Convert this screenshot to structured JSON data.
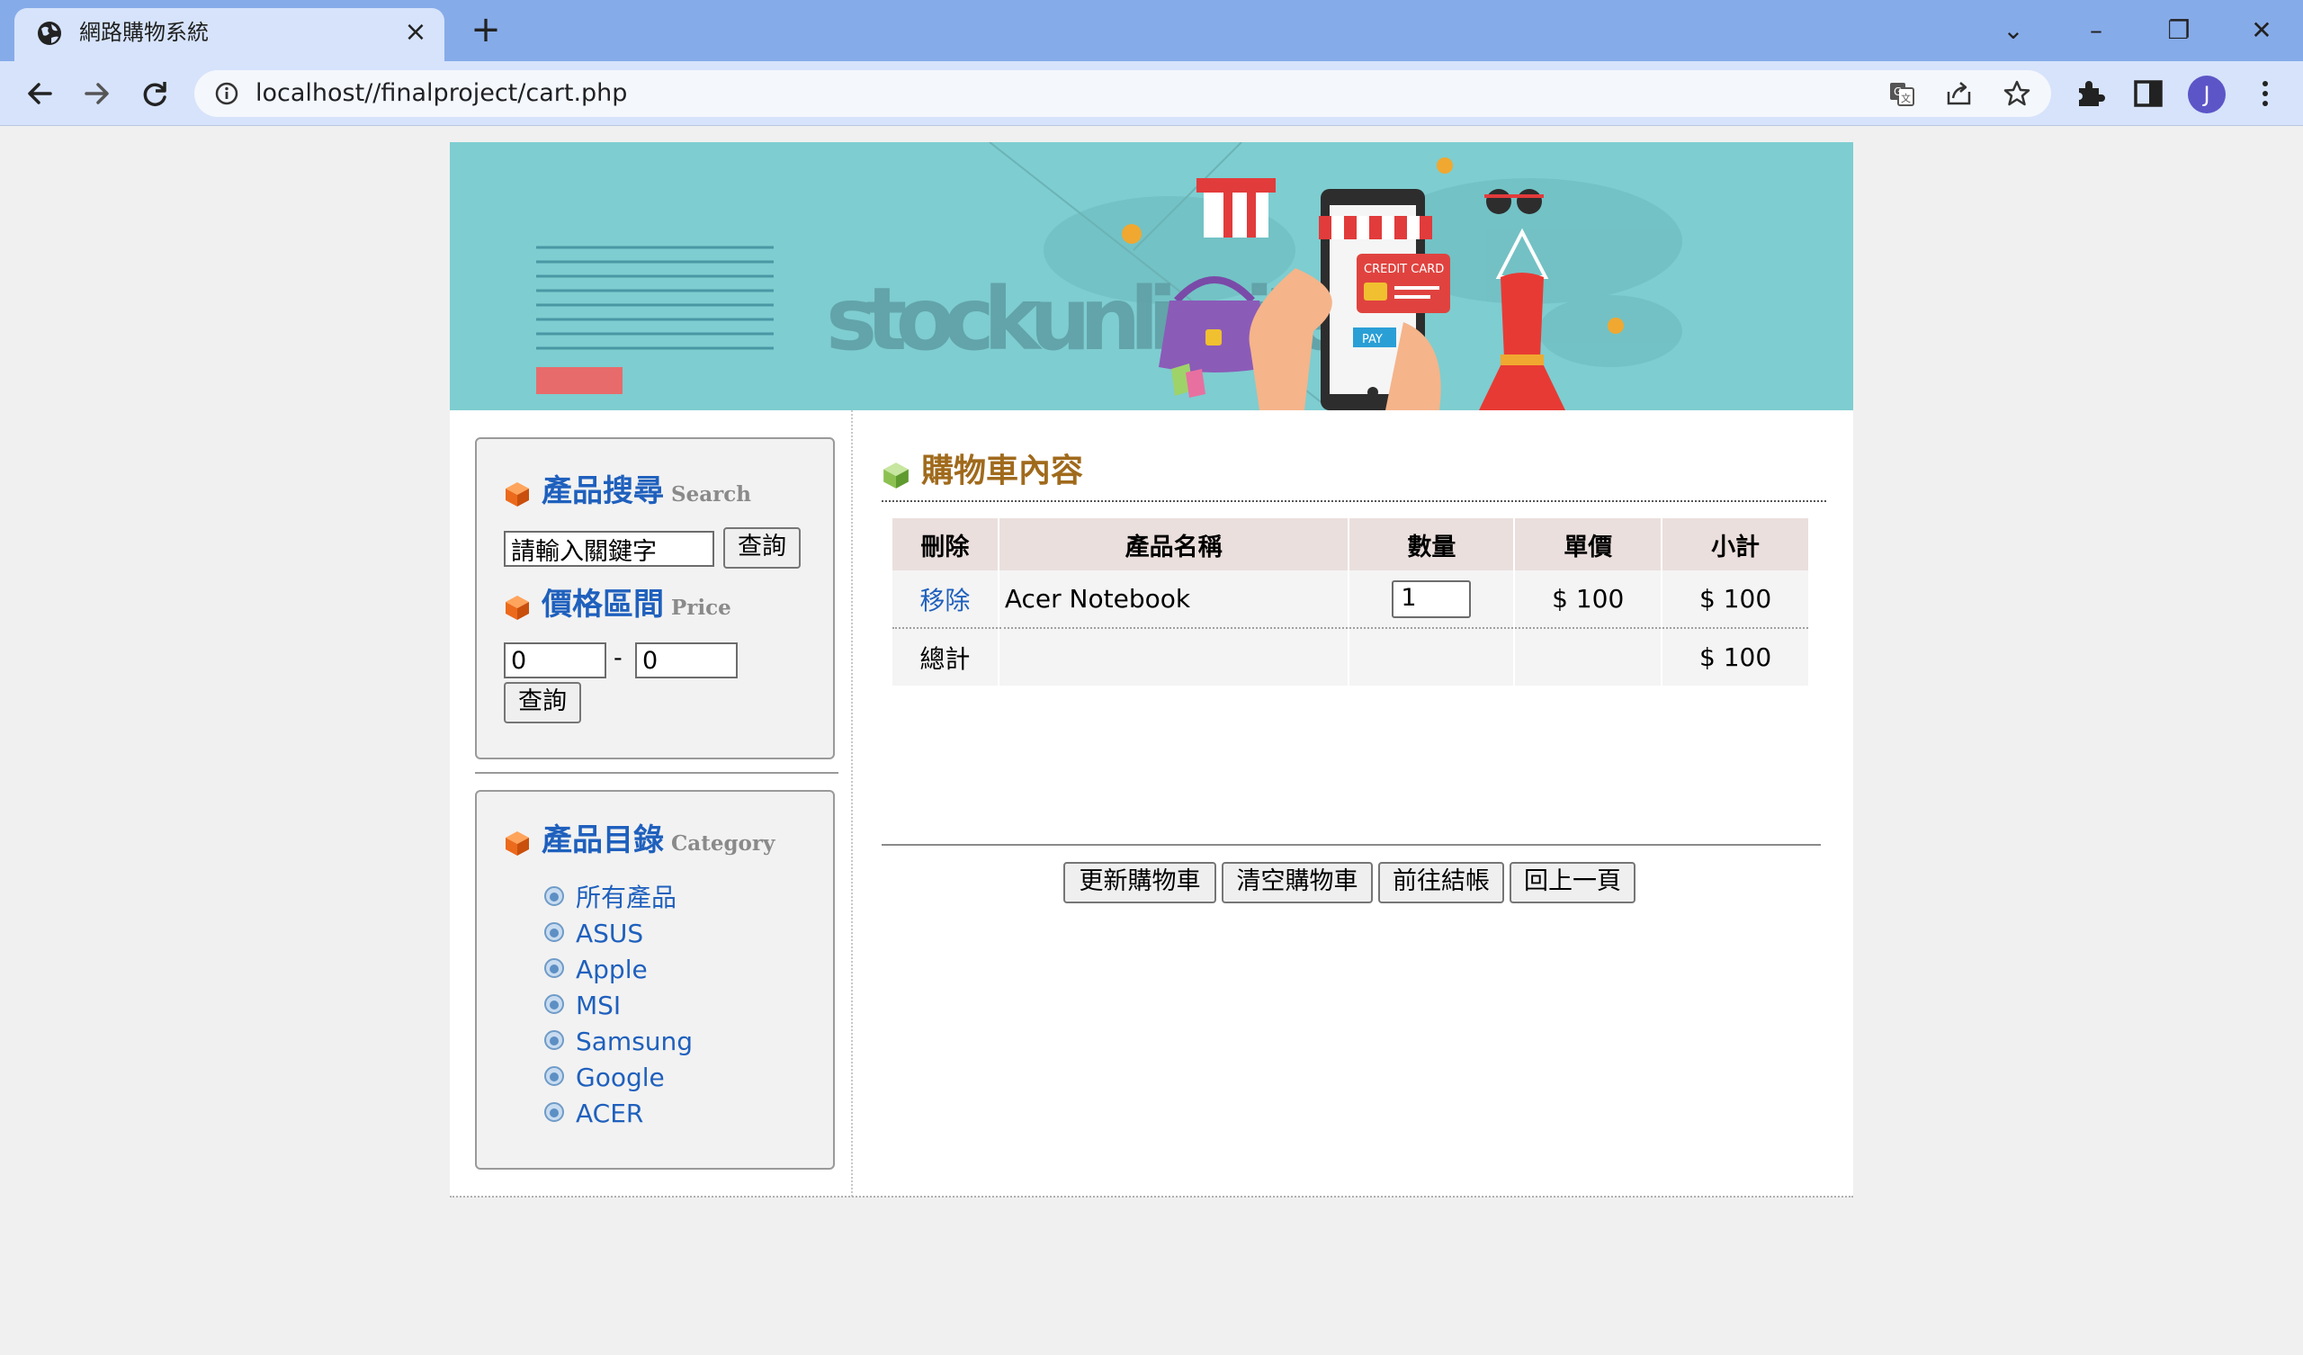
{
  "browser": {
    "tab_title": "網路購物系統",
    "tab_close": "×",
    "new_tab": "+",
    "url": "localhost//finalproject/cart.php",
    "profile_initial": "J",
    "window_controls": {
      "tab_search": "⌄",
      "minimize": "–",
      "restore": "❐",
      "close": "✕"
    }
  },
  "banner": {
    "watermark": "stockunlimited",
    "credit_card_text": "CREDIT CARD",
    "pay_text": "PAY"
  },
  "sidebar": {
    "search": {
      "title": "產品搜尋",
      "subtitle": "Search",
      "keyword_value": "請輸入關鍵字",
      "button": "查詢"
    },
    "price": {
      "title": "價格區間",
      "subtitle": "Price",
      "min_value": "0",
      "separator": "-",
      "max_value": "0",
      "button": "查詢"
    },
    "category": {
      "title": "產品目錄",
      "subtitle": "Category",
      "items": [
        "所有產品",
        "ASUS",
        "Apple",
        "MSI",
        "Samsung",
        "Google",
        "ACER"
      ]
    }
  },
  "main": {
    "title": "購物車內容",
    "columns": [
      "刪除",
      "產品名稱",
      "數量",
      "單價",
      "小計"
    ],
    "rows": [
      {
        "remove": "移除",
        "name": "Acer Notebook",
        "qty": "1",
        "price": "$ 100",
        "subtotal": "$ 100"
      }
    ],
    "total_label": "總計",
    "total_value": "$ 100",
    "buttons": {
      "update": "更新購物車",
      "clear": "清空購物車",
      "checkout": "前往結帳",
      "back": "回上一頁"
    }
  },
  "colors": {
    "chrome_tab_strip": "#86abe9",
    "chrome_toolbar": "#d6e3fb",
    "banner": "#7ecdd0",
    "link": "#1f60bd",
    "heading": "#a06a1c",
    "total": "#e00000"
  },
  "icons": [
    "globe-icon",
    "back-arrow-icon",
    "forward-arrow-icon",
    "reload-icon",
    "info-icon",
    "translate-icon",
    "share-icon",
    "star-icon",
    "extensions-icon",
    "side-panel-icon",
    "more-menu-icon",
    "cube-icon",
    "bullet-icon"
  ]
}
